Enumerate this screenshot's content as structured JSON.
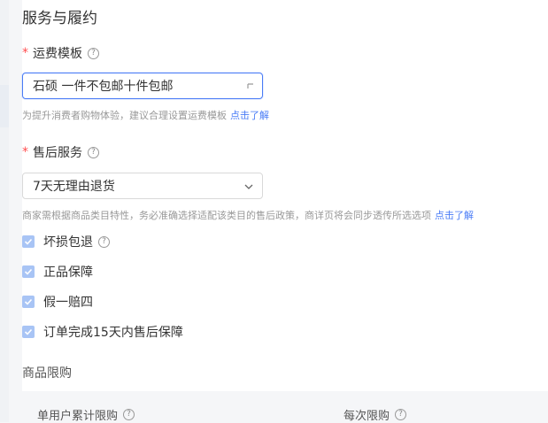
{
  "section": {
    "title": "服务与履约"
  },
  "freight": {
    "label": "运费模板",
    "help_icon": "question-circle-icon",
    "value": "石硕 一件不包邮十件包邮",
    "hint": "为提升消费者购物体验，建议合理设置运费模板",
    "hint_link": "点击了解"
  },
  "aftersale": {
    "label": "售后服务",
    "help_icon": "question-circle-icon",
    "value": "7天无理由退货",
    "hint": "商家需根据商品类目特性，务必准确选择适配该类目的售后政策，商详页将会同步透传所选选项",
    "hint_link": "点击了解",
    "options": [
      {
        "label": "坏损包退",
        "checked": true,
        "has_help": true
      },
      {
        "label": "正品保障",
        "checked": true,
        "has_help": false
      },
      {
        "label": "假一赔四",
        "checked": true,
        "has_help": false
      },
      {
        "label": "订单完成15天内售后保障",
        "checked": true,
        "has_help": false
      }
    ]
  },
  "purchase_limit": {
    "title": "商品限购",
    "columns": [
      "单用户累计限购",
      "每次限购"
    ]
  },
  "colors": {
    "accent": "#4a7cf6",
    "required": "#ff4d4f",
    "checkbox": "#a8c4f5"
  }
}
